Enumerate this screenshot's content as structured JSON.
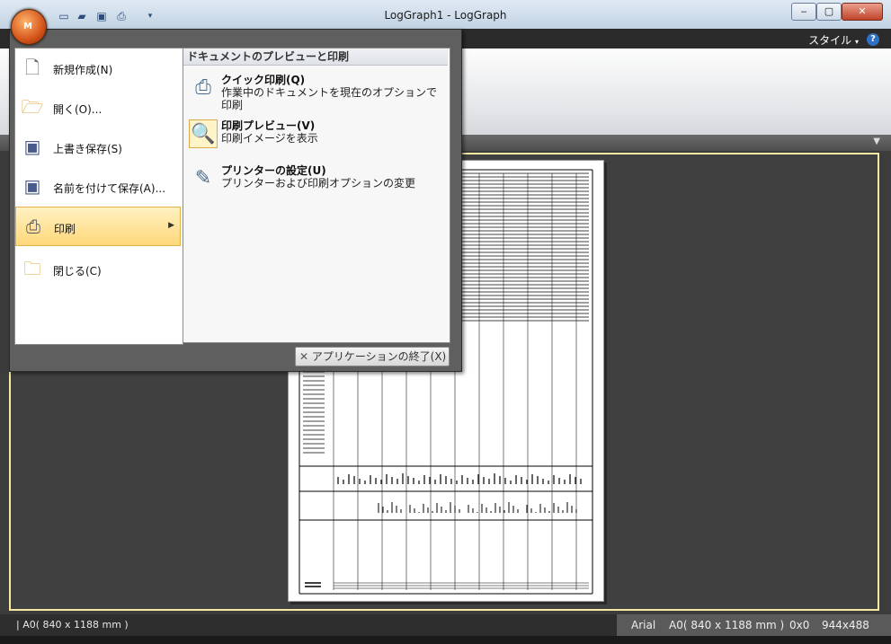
{
  "window": {
    "title": "LogGraph1 - LogGraph",
    "minimize_glyph": "‒",
    "maximize_glyph": "▢",
    "close_glyph": "✕"
  },
  "quick_access": [
    "new-icon",
    "open-icon",
    "save-icon",
    "print-icon",
    "customize-icon"
  ],
  "ribbon": {
    "style_label": "スタイル",
    "help_glyph": "?"
  },
  "app_menu": {
    "orb_mark": "M",
    "items": [
      {
        "label": "新規作成(N)",
        "icon": "new-document-icon"
      },
      {
        "label": "開く(O)...",
        "icon": "open-folder-icon"
      },
      {
        "label": "上書き保存(S)",
        "icon": "save-icon"
      },
      {
        "label": "名前を付けて保存(A)...",
        "icon": "save-as-icon"
      },
      {
        "label": "印刷",
        "icon": "print-icon",
        "active": true
      },
      {
        "label": "閉じる(C)",
        "icon": "close-folder-icon"
      }
    ],
    "print_panel": {
      "header": "ドキュメントのプレビューと印刷",
      "items": [
        {
          "title": "クイック印刷(Q)",
          "desc": "作業中のドキュメントを現在のオプションで印刷",
          "icon": "quick-print-icon"
        },
        {
          "title": "印刷プレビュー(V)",
          "desc": "印刷イメージを表示",
          "icon": "print-preview-icon"
        },
        {
          "title": "プリンターの設定(U)",
          "desc": "プリンターおよび印刷オプションの変更",
          "icon": "printer-settings-icon"
        }
      ]
    },
    "exit_label": "アプリケーションの終了(X)"
  },
  "status_bar": {
    "left": "|  A0( 840 x 1188 mm )",
    "font": "Arial",
    "paper": "A0( 840 x 1188 mm )",
    "position": "0x0",
    "size": "944x488"
  },
  "colors": {
    "accent_highlight": "#ffd87a",
    "document_border": "#f5e9a4",
    "workspace": "#404040"
  }
}
